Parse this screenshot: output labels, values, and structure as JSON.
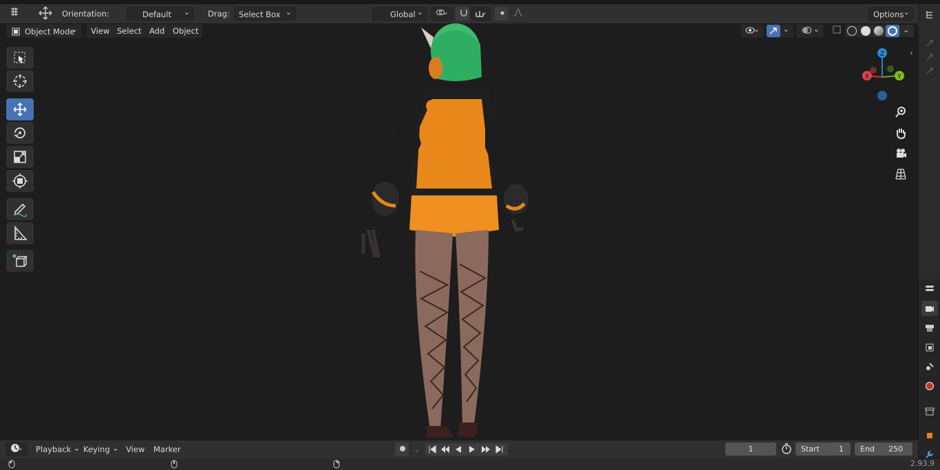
{
  "header": {
    "orientation_label": "Orientation:",
    "orientation_value": "Default",
    "drag_label": "Drag:",
    "drag_value": "Select Box",
    "transform_space": "Global",
    "options_label": "Options"
  },
  "viewport_header": {
    "mode": "Object Mode",
    "menus": [
      "View",
      "Select",
      "Add",
      "Object"
    ]
  },
  "tools": [
    "select-box-tool",
    "cursor-tool",
    "move-tool",
    "rotate-tool",
    "scale-tool",
    "transform-tool",
    "annotate-tool",
    "measure-tool",
    "add-cube-tool"
  ],
  "gizmo": {
    "z": "Z",
    "y": "Y",
    "x": "X"
  },
  "timeline": {
    "menus": [
      "Playback",
      "Keying",
      "View",
      "Marker"
    ],
    "current_frame": "1",
    "start_label": "Start",
    "start_value": "1",
    "end_label": "End",
    "end_value": "250"
  },
  "status": {
    "version": "2.93.9"
  },
  "colors": {
    "accent": "#4772b3",
    "header": "#303030",
    "viewport": "#1d1d1d"
  }
}
